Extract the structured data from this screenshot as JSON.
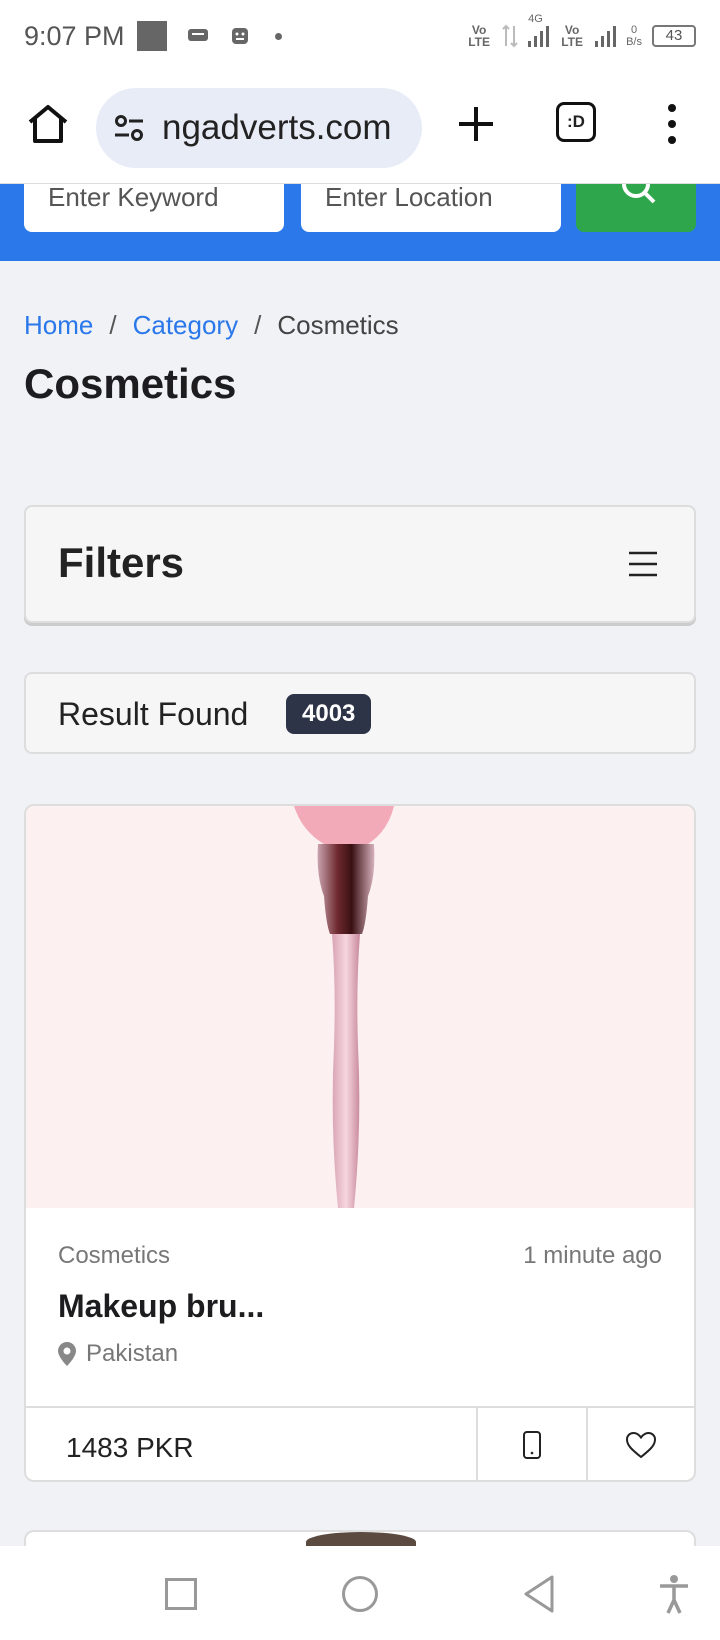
{
  "status": {
    "time": "9:07 PM",
    "volte1": "Vo LTE",
    "net": "4G",
    "volte2": "Vo LTE",
    "speed_value": "0",
    "speed_unit": "B/s",
    "battery": "43"
  },
  "browser": {
    "url": "ngadverts.com",
    "tab_label": ":D"
  },
  "search": {
    "keyword_placeholder": "Enter Keyword",
    "location_placeholder": "Enter Location"
  },
  "breadcrumb": {
    "home": "Home",
    "sep": "/",
    "category": "Category",
    "current": "Cosmetics"
  },
  "page_title": "Cosmetics",
  "filters": {
    "title": "Filters"
  },
  "results": {
    "label": "Result Found",
    "count": "4003"
  },
  "listing": {
    "category": "Cosmetics",
    "time": "1 minute ago",
    "title": "Makeup bru...",
    "location": "Pakistan",
    "price": "1483 PKR"
  },
  "colors": {
    "accent_blue": "#2a78ea",
    "search_green": "#2ea64c",
    "badge_dark": "#2e3447"
  }
}
